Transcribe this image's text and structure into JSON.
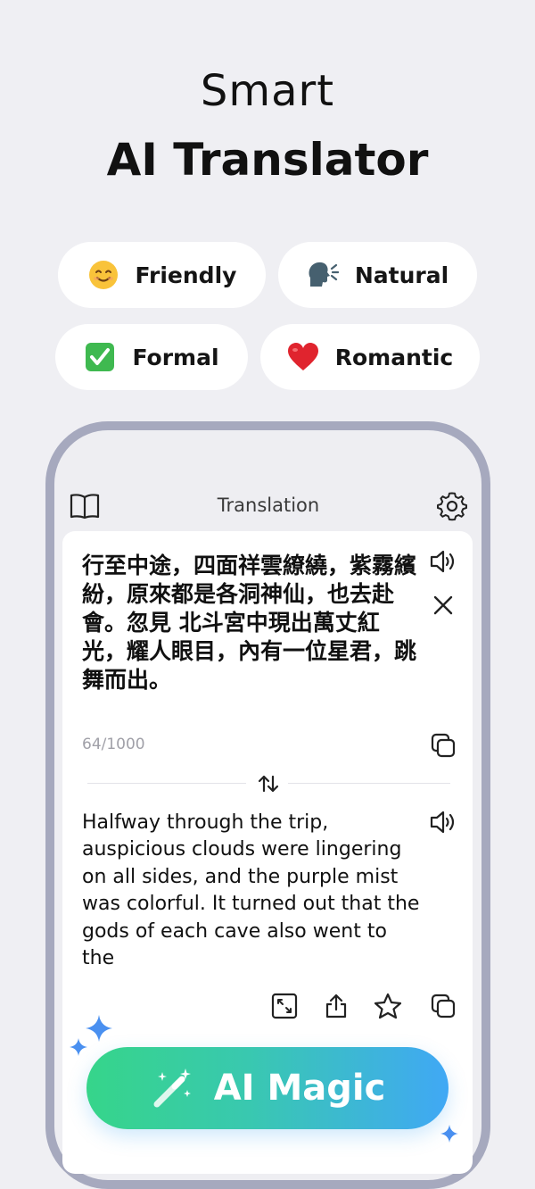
{
  "hero": {
    "line1": "Smart",
    "line2": "AI Translator"
  },
  "styles": [
    {
      "label": "Friendly",
      "emoji": "😊",
      "icon": "smiling-face-icon"
    },
    {
      "label": "Natural",
      "emoji": "🗣",
      "icon": "speaking-head-icon"
    },
    {
      "label": "Formal",
      "emoji": "✅",
      "icon": "check-mark-icon"
    },
    {
      "label": "Romantic",
      "emoji": "❤️",
      "icon": "red-heart-icon"
    }
  ],
  "app": {
    "title": "Translation",
    "source_text": "行至中途，四面祥雲繚繞，紫霧繽紛，原來都是各洞神仙，也去赴會。忽見 北斗宮中現出萬丈紅光，耀人眼目，內有一位星君，跳舞而出。",
    "char_count": "64/1000",
    "translation": "Halfway through the trip, auspicious clouds were lingering on all sides, and the purple mist was colorful. It turned out that the gods of each cave also went to the",
    "magic_button": "AI Magic"
  },
  "colors": {
    "background": "#efeff3",
    "phone_frame": "#a6a9be",
    "gradient_start": "#36d58a",
    "gradient_end": "#40a8f5",
    "sparkle": "#4a90f0"
  }
}
